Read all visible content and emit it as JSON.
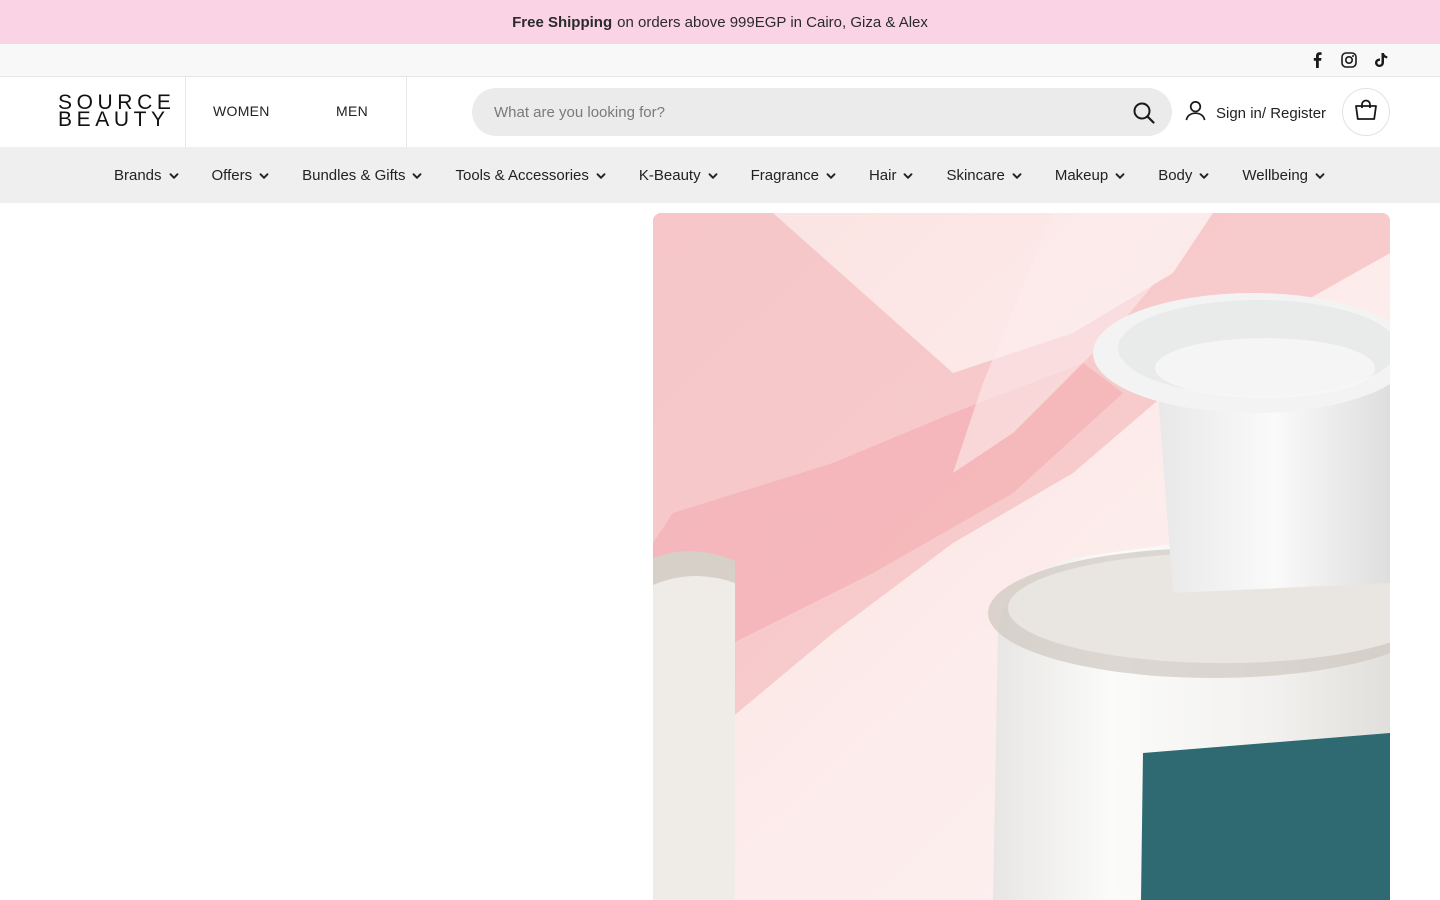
{
  "announcement": {
    "bold": "Free Shipping",
    "text": "on orders above 999EGP in Cairo, Giza & Alex"
  },
  "social": {
    "icons": [
      "facebook-icon",
      "instagram-icon",
      "tiktok-icon"
    ]
  },
  "header": {
    "logo_line1": "SOURCE",
    "logo_line2": "BEAUTY",
    "gender_women": "WOMEN",
    "gender_men": "MEN",
    "search_placeholder": "What are you looking for?",
    "search_value": "",
    "signin_label": "Sign in/ Register"
  },
  "categories": [
    {
      "label": "Brands"
    },
    {
      "label": "Offers"
    },
    {
      "label": "Bundles & Gifts"
    },
    {
      "label": "Tools & Accessories"
    },
    {
      "label": "K-Beauty"
    },
    {
      "label": "Fragrance"
    },
    {
      "label": "Hair"
    },
    {
      "label": "Skincare"
    },
    {
      "label": "Makeup"
    },
    {
      "label": "Body"
    },
    {
      "label": "Wellbeing"
    }
  ],
  "colors": {
    "announcement_bg": "#fad4e4",
    "nav_bg": "#efefef",
    "search_bg": "#ebebeb",
    "hero_teal": "#2f6a72",
    "hero_pink": "#f4a9ae"
  }
}
